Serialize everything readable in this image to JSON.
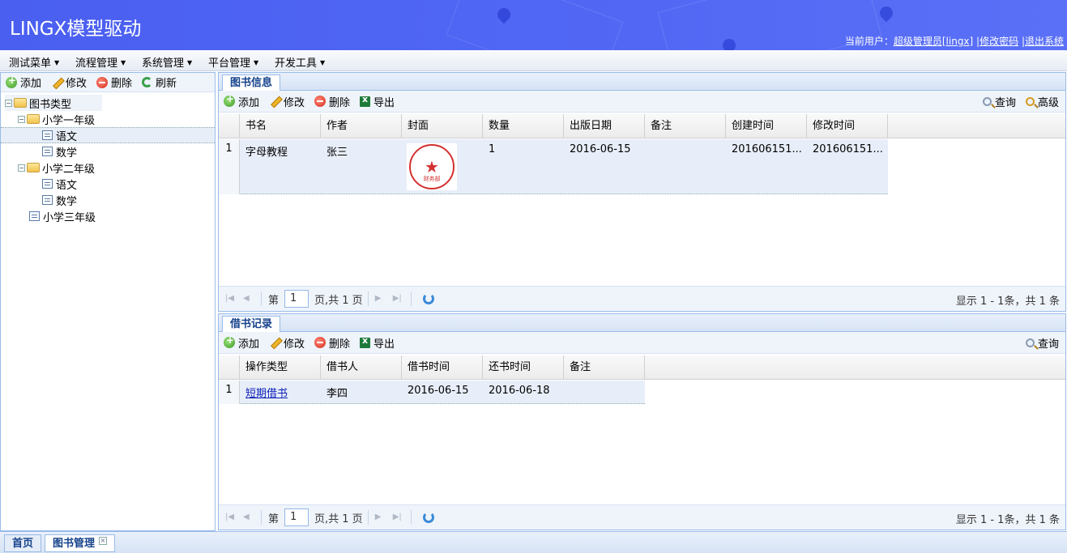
{
  "header": {
    "title": "LINGX模型驱动",
    "user_prefix": "当前用户：",
    "user_name": "超级管理员[lingx]",
    "sep": "|",
    "change_password": "修改密码",
    "logout": "退出系统",
    "bg_color": "#5066f4"
  },
  "menubar": [
    "测试菜单",
    "流程管理",
    "系统管理",
    "平台管理",
    "开发工具"
  ],
  "left": {
    "toolbar": [
      "添加",
      "修改",
      "删除",
      "刷新"
    ],
    "tree": [
      {
        "label": "图书类型"
      },
      {
        "label": "小学一年级"
      },
      {
        "label": "语文"
      },
      {
        "label": "数学"
      },
      {
        "label": "小学二年级"
      },
      {
        "label": "语文"
      },
      {
        "label": "数学"
      },
      {
        "label": "小学三年级"
      }
    ]
  },
  "books": {
    "tab": "图书信息",
    "toolbar": [
      "添加",
      "修改",
      "删除",
      "导出"
    ],
    "toolbar_right": [
      "查询",
      "高级"
    ],
    "columns": [
      "书名",
      "作者",
      "封面",
      "数量",
      "出版日期",
      "备注",
      "创建时间",
      "修改时间"
    ],
    "rows": [
      {
        "num": "1",
        "cells": [
          "字母教程",
          "张三",
          "",
          "1",
          "2016-06-15",
          "",
          "201606151...",
          "201606151..."
        ]
      }
    ],
    "stamp_text": "财务部",
    "pager": {
      "prefix": "第",
      "page": "1",
      "suffix": "页,共 1 页",
      "info": "显示 1 - 1条，共 1 条"
    }
  },
  "borrow": {
    "tab": "借书记录",
    "toolbar": [
      "添加",
      "修改",
      "删除",
      "导出"
    ],
    "toolbar_right": [
      "查询"
    ],
    "columns": [
      "操作类型",
      "借书人",
      "借书时间",
      "还书时间",
      "备注"
    ],
    "rows": [
      {
        "num": "1",
        "cells": [
          "短期借书",
          "李四",
          "2016-06-15",
          "2016-06-18",
          ""
        ]
      }
    ],
    "pager": {
      "prefix": "第",
      "page": "1",
      "suffix": "页,共 1 页",
      "info": "显示 1 - 1条，共 1 条"
    }
  },
  "bottom_tabs": [
    "首页",
    "图书管理"
  ]
}
